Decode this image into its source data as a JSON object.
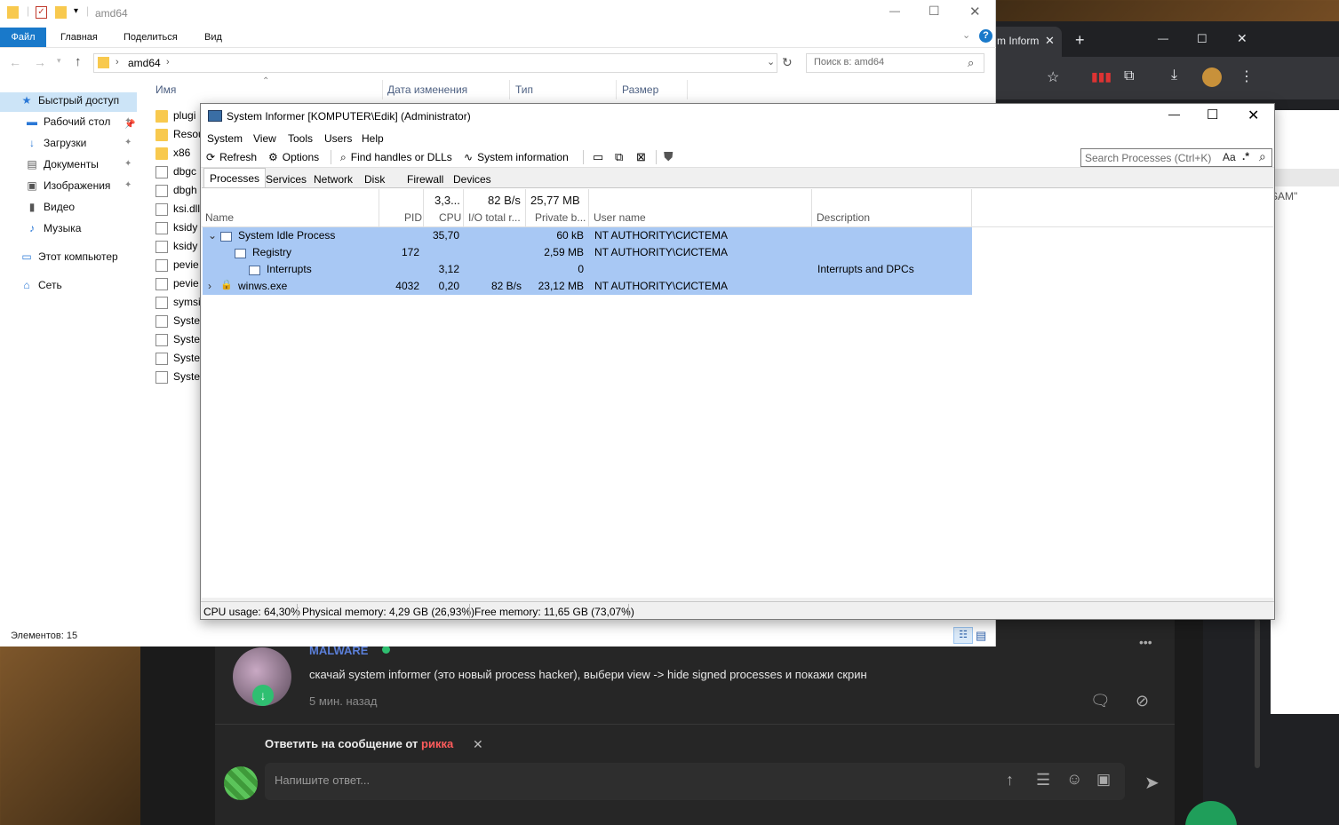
{
  "explorer": {
    "title": "amd64",
    "ribbon_tabs": [
      "Файл",
      "Главная",
      "Поделиться",
      "Вид"
    ],
    "address": "amd64",
    "search_placeholder": "Поиск в: amd64",
    "columns": [
      "Имя",
      "Дата изменения",
      "Тип",
      "Размер"
    ],
    "nav": [
      {
        "label": "Быстрый доступ",
        "icon": "star-icon"
      },
      {
        "label": "Рабочий стол",
        "icon": "desktop-icon"
      },
      {
        "label": "Загрузки",
        "icon": "download-icon"
      },
      {
        "label": "Документы",
        "icon": "documents-icon"
      },
      {
        "label": "Изображения",
        "icon": "images-icon"
      },
      {
        "label": "Видео",
        "icon": "video-icon"
      },
      {
        "label": "Музыка",
        "icon": "music-icon"
      },
      {
        "label": "Этот компьютер",
        "icon": "computer-icon"
      },
      {
        "label": "Сеть",
        "icon": "network-icon"
      }
    ],
    "files": [
      "plugi",
      "Resou",
      "x86",
      "dbgc",
      "dbgh",
      "ksi.dll",
      "ksidy",
      "ksidy",
      "pevie",
      "pevie",
      "symsi",
      "Syster",
      "Syster",
      "Syster",
      "Syster"
    ],
    "item_count": "Элементов: 15"
  },
  "chrome": {
    "tab_title": "m Inform",
    "new_tab": "+",
    "page_text": "SAM\""
  },
  "si": {
    "title": "System Informer [KOMPUTER\\Edik] (Administrator)",
    "menu": [
      "System",
      "View",
      "Tools",
      "Users",
      "Help"
    ],
    "toolbar": {
      "refresh": "Refresh",
      "options": "Options",
      "find": "Find handles or DLLs",
      "sysinfo": "System information"
    },
    "search_placeholder": "Search Processes (Ctrl+K)",
    "search_case": "Aa",
    "search_regex": ".*",
    "tabs": [
      "Processes",
      "Services",
      "Network",
      "Disk",
      "Firewall",
      "Devices"
    ],
    "totals": {
      "cpu": "3,3...",
      "io": "82 B/s",
      "private": "25,77 MB"
    },
    "columns": {
      "name": "Name",
      "pid": "PID",
      "cpu": "CPU",
      "io": "I/O total r...",
      "private": "Private b...",
      "user": "User name",
      "desc": "Description"
    },
    "processes": [
      {
        "name": "System Idle Process",
        "pid": "",
        "cpu": "35,70",
        "io": "",
        "private": "60 kB",
        "user": "NT AUTHORITY\\СИСТЕМА",
        "desc": ""
      },
      {
        "name": "Registry",
        "pid": "172",
        "cpu": "",
        "io": "",
        "private": "2,59 MB",
        "user": "NT AUTHORITY\\СИСТЕМА",
        "desc": ""
      },
      {
        "name": "Interrupts",
        "pid": "",
        "cpu": "3,12",
        "io": "",
        "private": "0",
        "user": "",
        "desc": "Interrupts and DPCs"
      },
      {
        "name": "winws.exe",
        "pid": "4032",
        "cpu": "0,20",
        "io": "82 B/s",
        "private": "23,12 MB",
        "user": "NT AUTHORITY\\СИСТЕМА",
        "desc": ""
      }
    ],
    "status": {
      "cpu": "CPU usage: 64,30%",
      "physical": "Physical memory: 4,29 GB (26,93%)",
      "free": "Free memory: 11,65 GB (73,07%)"
    }
  },
  "chat": {
    "author": "MALWARE",
    "message": "скачай system informer (это новый process hacker), выбери view -> hide signed processes и покажи скрин",
    "time": "5 мин. назад",
    "reply_prefix": "Ответить на сообщение от",
    "reply_user": "рикка",
    "input_placeholder": "Напишите ответ...",
    "more": "•••"
  },
  "colors": {
    "selection": "#a8c8f4",
    "explorer_file_tab": "#1979ca",
    "chat_author": "#5b7fd8",
    "reply_user": "#ff5c5c",
    "chat_bg": "#262626"
  }
}
